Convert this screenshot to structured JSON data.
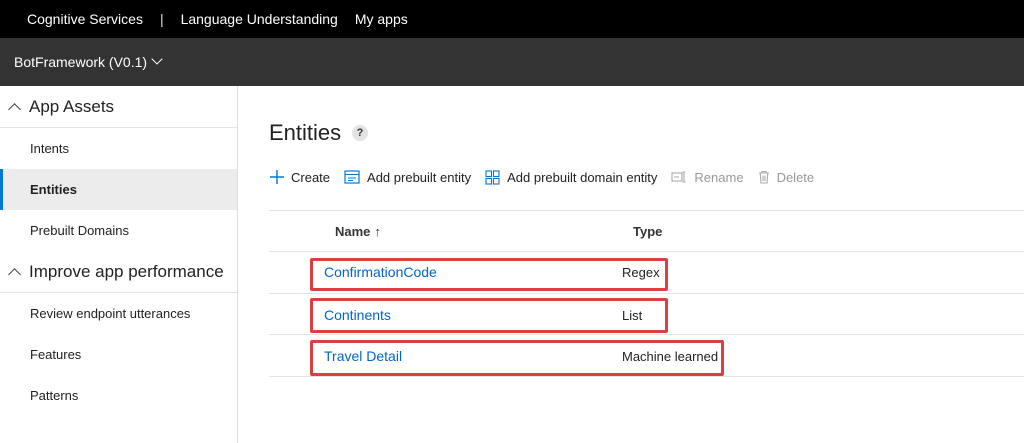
{
  "topbar": {
    "brand": "Cognitive Services",
    "separator": "|",
    "product": "Language Understanding",
    "my_apps": "My apps"
  },
  "appbar": {
    "app_name": "BotFramework (V0.1)"
  },
  "sidebar": {
    "sections": [
      {
        "title": "App Assets",
        "items": [
          "Intents",
          "Entities",
          "Prebuilt Domains"
        ]
      },
      {
        "title": "Improve app performance",
        "items": [
          "Review endpoint utterances",
          "Features",
          "Patterns"
        ]
      }
    ],
    "active_item": "Entities"
  },
  "main": {
    "title": "Entities",
    "help": "?",
    "toolbar": {
      "create": "Create",
      "add_prebuilt": "Add prebuilt entity",
      "add_prebuilt_domain": "Add prebuilt domain entity",
      "rename": "Rename",
      "delete": "Delete"
    },
    "columns": {
      "name": "Name",
      "sort_indicator": "↑",
      "type": "Type"
    },
    "rows": [
      {
        "name": "ConfirmationCode",
        "type": "Regex"
      },
      {
        "name": "Continents",
        "type": "List"
      },
      {
        "name": "Travel Detail",
        "type": "Machine learned"
      }
    ]
  },
  "colors": {
    "highlight": "#d9403f",
    "link": "#0066cc",
    "accent": "#0078d4"
  }
}
